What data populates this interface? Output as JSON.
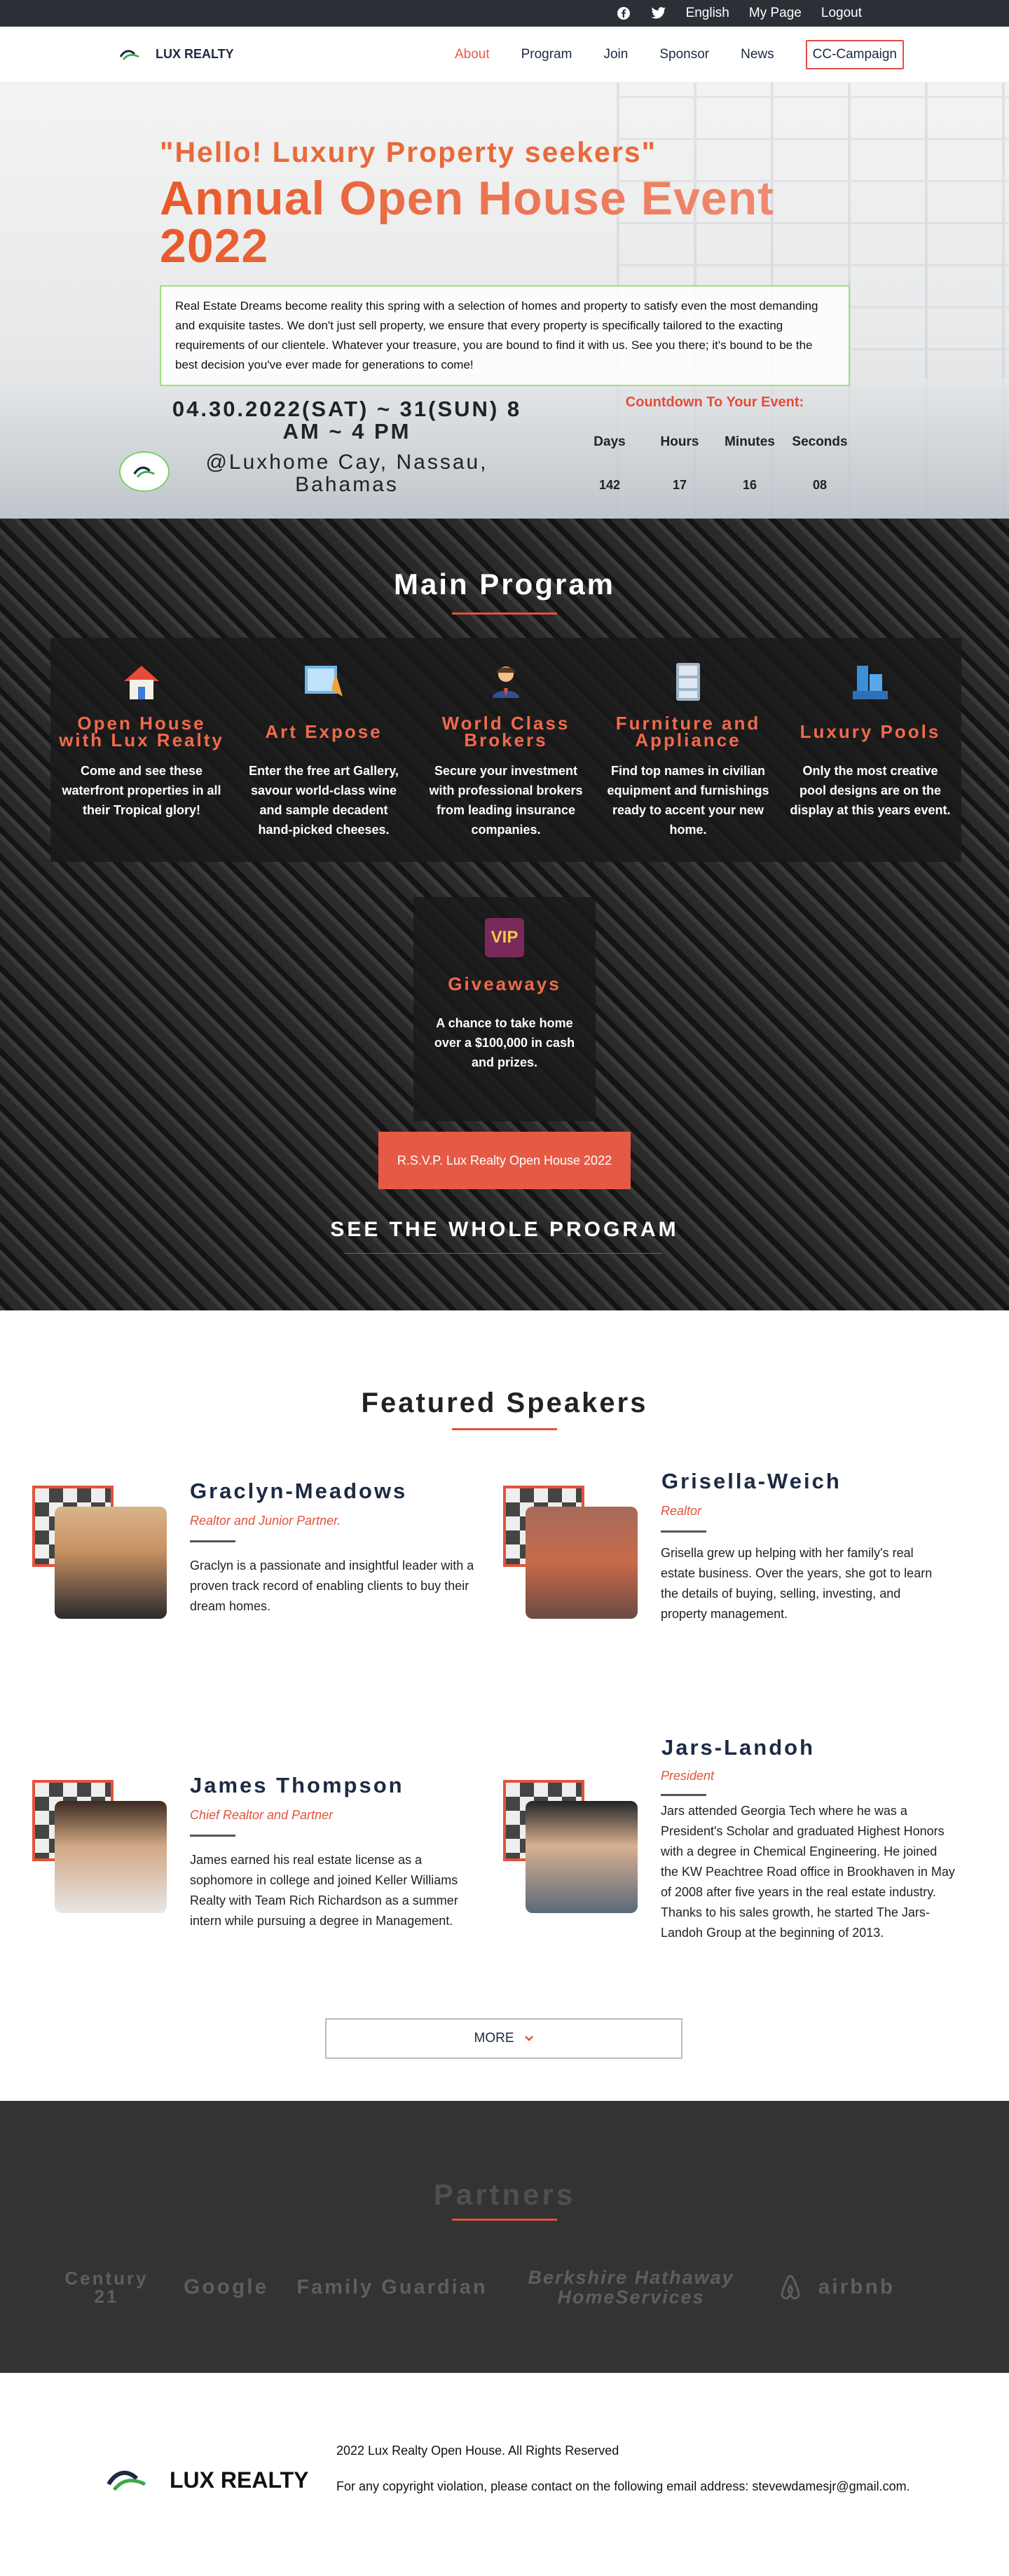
{
  "topbar": {
    "language": "English",
    "my_page": "My Page",
    "logout": "Logout"
  },
  "nav": {
    "brand": "LUX REALTY",
    "items": [
      "About",
      "Program",
      "Join",
      "Sponsor",
      "News",
      "CC-Campaign"
    ]
  },
  "hero": {
    "tagline": "\"Hello! Luxury Property seekers\"",
    "title": "Annual Open House Event 2022",
    "intro": "Real Estate Dreams become reality this spring with a selection of homes and property to satisfy even the most demanding and exquisite tastes. We don't just sell property, we ensure that every property is specifically tailored to the exacting requirements of our clientele. Whatever your treasure, you are bound to find it with us. See you there; it's bound to be the best decision you've ever made for generations to come!",
    "date": "04.30.2022(SAT) ~ 31(SUN) 8 AM ~ 4 PM",
    "place": "@Luxhome Cay, Nassau, Bahamas",
    "countdown_label": "Countdown To Your Event:",
    "units": [
      "Days",
      "Hours",
      "Minutes",
      "Seconds"
    ],
    "values": [
      "142",
      "17",
      "16",
      "08"
    ]
  },
  "program": {
    "title": "Main Program",
    "cards": [
      {
        "title": "Open House with Lux Realty",
        "text": "Come and see these waterfront properties in all their Tropical glory!",
        "icon": "house-icon"
      },
      {
        "title": "Art Expose",
        "text": "Enter the free art Gallery, savour world-class wine and sample decadent hand-picked cheeses.",
        "icon": "art-icon"
      },
      {
        "title": "World Class Brokers",
        "text": "Secure your investment with professional brokers from leading insurance companies.",
        "icon": "broker-icon"
      },
      {
        "title": "Furniture and Appliance",
        "text": "Find top names in civilian equipment and furnishings ready to accent your new home.",
        "icon": "cabinet-icon"
      },
      {
        "title": "Luxury Pools",
        "text": "Only the most creative pool designs are on the display at this years event.",
        "icon": "pool-icon"
      },
      {
        "title": "Giveaways",
        "text": "A chance to take home over a $100,000 in cash and prizes.",
        "icon": "vip-icon",
        "badge": "VIP"
      }
    ],
    "rsvp": "R.S.V.P. Lux Realty Open House 2022",
    "whole": "SEE THE WHOLE PROGRAM"
  },
  "speakers": {
    "title": "Featured Speakers",
    "list": [
      {
        "name": "Graclyn-Meadows",
        "role": "Realtor and Junior Partner.",
        "bio": "Graclyn is a passionate and insightful leader with a proven track record of enabling clients to buy their dream homes."
      },
      {
        "name": "Grisella-Weich",
        "role": "Realtor",
        "bio": "Grisella grew up helping with her family's real estate business. Over the years, she got to learn the details of buying, selling, investing, and property management."
      },
      {
        "name": "James Thompson",
        "role": "Chief Realtor and Partner",
        "bio": "James earned his real estate license as a sophomore in college and joined Keller Williams Realty with Team Rich Richardson as a summer intern while pursuing a degree in Management."
      },
      {
        "name": "Jars-Landoh",
        "role": "President",
        "bio": "Jars attended Georgia Tech where he was a President's Scholar and graduated Highest Honors with a degree in Chemical Engineering. He joined the KW Peachtree Road office in Brookhaven in May of 2008 after five years in the real estate industry. Thanks to his sales growth, he started The Jars-Landoh Group at the beginning of 2013."
      }
    ],
    "more": "MORE"
  },
  "partners": {
    "title": "Partners",
    "logos": [
      "Century 21",
      "Google",
      "Family Guardian",
      "Berkshire Hathaway HomeServices",
      "airbnb"
    ]
  },
  "footer": {
    "brand": "LUX REALTY",
    "copyright": "2022 Lux Realty Open House. All Rights Reserved",
    "contact": "For any copyright violation, please contact on the following email address: stevewdamesjr@gmail.com."
  },
  "colors": {
    "accent": "#e2533c",
    "dark": "#2c2f36",
    "navy": "#1c2a44"
  }
}
